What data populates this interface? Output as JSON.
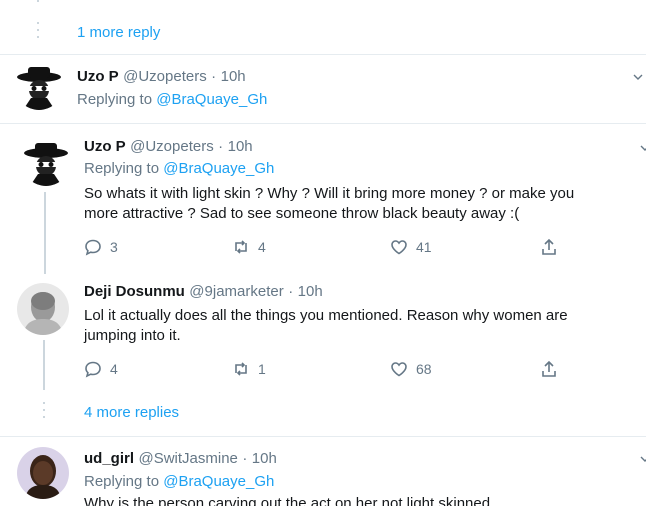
{
  "top_more": {
    "label": "1 more reply"
  },
  "tweet1": {
    "name": "Uzo P",
    "handle": "@Uzopeters",
    "dot": "·",
    "time": "10h",
    "replying_prefix": "Replying to",
    "replying_to": "@BraQuaye_Gh"
  },
  "tweet2": {
    "name": "Uzo P",
    "handle": "@Uzopeters",
    "dot": "·",
    "time": "10h",
    "replying_prefix": "Replying to",
    "replying_to": "@BraQuaye_Gh",
    "text_line1": "So whats it with light skin ? Why ? Will it bring more money ? or make you",
    "text_line2": "more attractive ? Sad to see someone throw black beauty away :(",
    "replies": "3",
    "retweets": "4",
    "likes": "41"
  },
  "tweet3": {
    "name": "Deji Dosunmu",
    "handle": "@9jamarketer",
    "dot": "·",
    "time": "10h",
    "text_line1": "Lol it actually does all the things you mentioned. Reason why women are",
    "text_line2": "jumping into it.",
    "replies": "4",
    "retweets": "1",
    "likes": "68"
  },
  "more_replies": {
    "label": "4 more replies"
  },
  "tweet4": {
    "name": "ud_girl",
    "handle": "@SwitJasmine",
    "dot": "·",
    "time": "10h",
    "replying_prefix": "Replying to",
    "replying_to": "@BraQuaye_Gh",
    "text_line1": "Why is the person carving out the act on her not light skinned"
  },
  "icons": {
    "reply": "reply-icon",
    "retweet": "retweet-icon",
    "like": "heart-icon",
    "share": "share-icon",
    "more": "chevron-down-icon"
  },
  "colors": {
    "accent": "#1da1f2",
    "muted": "#657786",
    "border": "#e6ecf0",
    "thread": "#ccd6dd"
  }
}
